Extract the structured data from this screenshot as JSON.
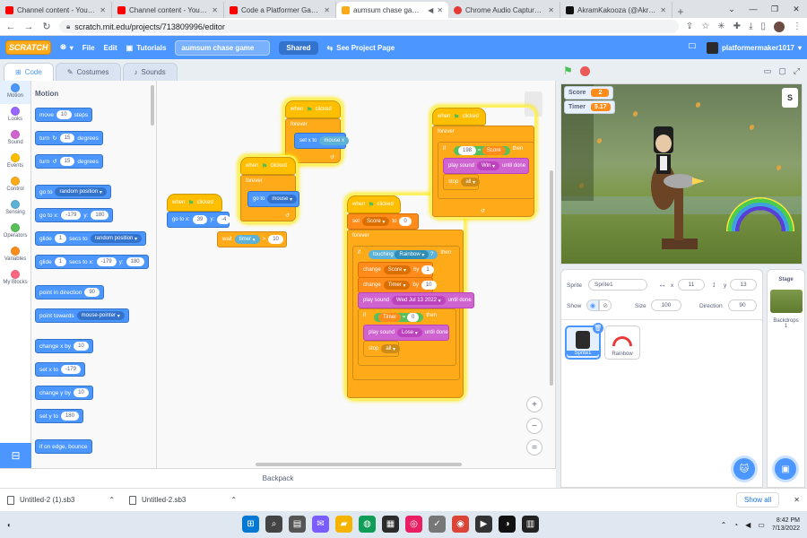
{
  "browser": {
    "tabs": [
      {
        "title": "Channel content - YouTube Studio",
        "color": "#ff0000"
      },
      {
        "title": "Channel content - YouTube Studio",
        "color": "#ff0000"
      },
      {
        "title": "Code a Platformer Game",
        "color": "#ff0000"
      },
      {
        "title": "aumsum chase game on Scratch",
        "color": "#fbab19",
        "active": true
      },
      {
        "title": "Chrome Audio Capture Options",
        "color": "#e53935"
      },
      {
        "title": "AkramKakooza (@AkramKakooza)",
        "color": "#111111"
      }
    ],
    "url": "scratch.mit.edu/projects/713809996/editor"
  },
  "menubar": {
    "logo": "SCRATCH",
    "file": "File",
    "edit": "Edit",
    "tutorials": "Tutorials",
    "project_title": "aumsum chase game",
    "shared": "Shared",
    "see_project": "See Project Page",
    "username": "platformermaker1017"
  },
  "editor_tabs": {
    "code": "Code",
    "costumes": "Costumes",
    "sounds": "Sounds"
  },
  "categories": [
    {
      "label": "Motion",
      "color": "#4c97ff"
    },
    {
      "label": "Looks",
      "color": "#9966ff"
    },
    {
      "label": "Sound",
      "color": "#cf63cf"
    },
    {
      "label": "Events",
      "color": "#ffbf00"
    },
    {
      "label": "Control",
      "color": "#ffab19"
    },
    {
      "label": "Sensing",
      "color": "#5cb1d6"
    },
    {
      "label": "Operators",
      "color": "#59c059"
    },
    {
      "label": "Variables",
      "color": "#ff8c1a"
    },
    {
      "label": "My Blocks",
      "color": "#ff6680"
    }
  ],
  "palette": {
    "heading": "Motion",
    "move": "move",
    "move_val": "10",
    "steps": "steps",
    "turn": "turn",
    "turn_val": "15",
    "degrees": "degrees",
    "goto": "go to",
    "random_position": "random position",
    "goto_x": "go to x:",
    "x_val": "-179",
    "y": "y:",
    "y_val": "180",
    "glide": "glide",
    "glide_val": "1",
    "secs_to": "secs to",
    "secs_to_x": "secs to x:",
    "point_dir": "point in direction",
    "dir_val": "90",
    "point_towards": "point towards",
    "mouse_pointer": "mouse-pointer",
    "change_x": "change x by",
    "change_x_val": "10",
    "set_x": "set x to",
    "set_x_val": "-179",
    "change_y": "change y by",
    "change_y_val": "10",
    "set_y": "set y to",
    "set_y_val": "180",
    "edge_bounce": "if on edge, bounce"
  },
  "scripts": {
    "when": "when",
    "clicked": "clicked",
    "forever": "forever",
    "set_x_to": "set x to",
    "mouse_x": "mouse x",
    "go_to": "go to",
    "mouse": "mouse",
    "go_to_x": "go to x:",
    "gx": "39",
    "y": "y:",
    "gy": "-4",
    "set_x_ok": "set x to",
    "wait": "wait",
    "timer_drop": "timer",
    "wait_val": "10",
    "set": "set",
    "score": "Score",
    "to": "to",
    "zero": "0",
    "if": "if",
    "touching": "touching",
    "rainbow": "Rainbow",
    "q": "?",
    "then": "then",
    "change": "change",
    "by": "by",
    "one": "1",
    "timer": "Timer",
    "ten": "10",
    "play_sound": "play sound",
    "date_sound": "Wed Jul 13 2022",
    "until_done": "until done",
    "eq": "=",
    "lose": "Lose",
    "stop": "stop",
    "all": "all",
    "n198": "198",
    "win": "Win"
  },
  "backpack": "Backpack",
  "stage": {
    "monitors": [
      {
        "label": "Score",
        "value": "2"
      },
      {
        "label": "Timer",
        "value": "5.17"
      }
    ]
  },
  "sprite_info": {
    "sprite_label": "Sprite",
    "sprite_name": "Sprite1",
    "x_label": "x",
    "x_val": "11",
    "y_label": "y",
    "y_val": "13",
    "show_label": "Show",
    "size_label": "Size",
    "size_val": "100",
    "direction_label": "Direction",
    "direction_val": "90"
  },
  "sprites": [
    {
      "name": "Sprite1",
      "selected": true
    },
    {
      "name": "Rainbow",
      "selected": false
    }
  ],
  "stage_pane": {
    "title": "Stage",
    "backdrops": "Backdrops",
    "count": "1"
  },
  "downloads": {
    "files": [
      "Untitled-2 (1).sb3",
      "Untitled-2.sb3"
    ],
    "show_all": "Show all"
  },
  "taskbar": {
    "time": "8:42 PM",
    "date": "7/13/2022"
  }
}
